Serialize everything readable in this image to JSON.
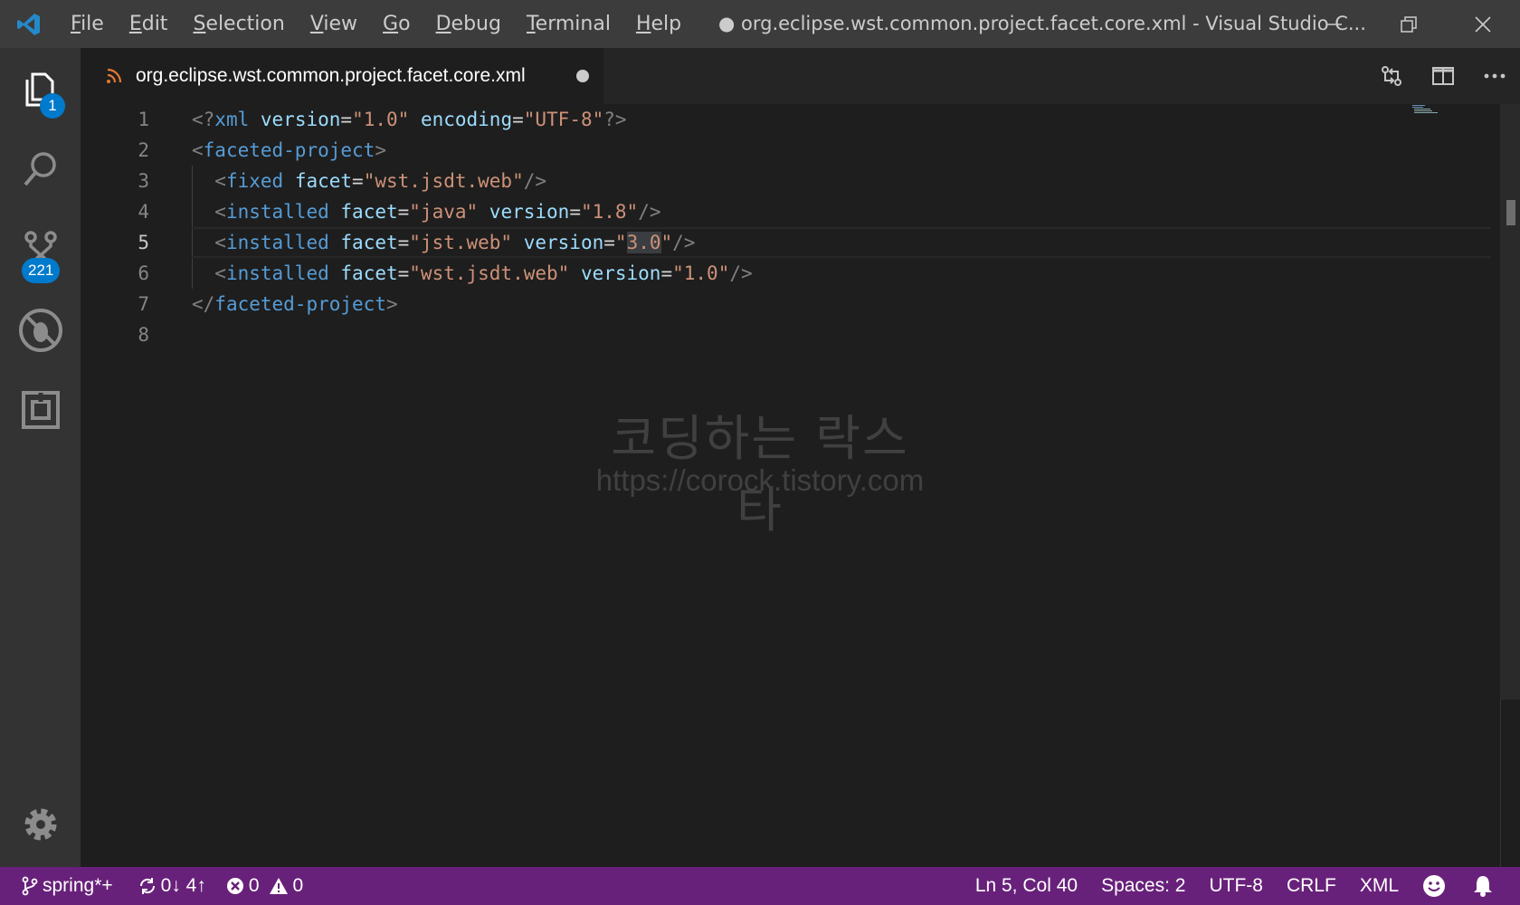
{
  "window": {
    "title": "● org.eclipse.wst.common.project.facet.core.xml - Visual Studio C..."
  },
  "menu": [
    {
      "mnemonic": "F",
      "rest": "ile"
    },
    {
      "mnemonic": "E",
      "rest": "dit"
    },
    {
      "mnemonic": "S",
      "rest": "election"
    },
    {
      "mnemonic": "V",
      "rest": "iew"
    },
    {
      "mnemonic": "G",
      "rest": "o"
    },
    {
      "mnemonic": "D",
      "rest": "ebug"
    },
    {
      "mnemonic": "T",
      "rest": "erminal"
    },
    {
      "mnemonic": "H",
      "rest": "elp"
    }
  ],
  "activity": {
    "explorer_badge": "1",
    "scm_badge": "221"
  },
  "tab": {
    "label": "org.eclipse.wst.common.project.facet.core.xml"
  },
  "editor": {
    "line_numbers": [
      "1",
      "2",
      "3",
      "4",
      "5",
      "6",
      "7",
      "8"
    ],
    "lines": [
      [
        [
          "punc",
          "<?"
        ],
        [
          "tag",
          "xml"
        ],
        [
          "eq",
          " "
        ],
        [
          "attr",
          "version"
        ],
        [
          "eq",
          "="
        ],
        [
          "str",
          "\"1.0\""
        ],
        [
          "eq",
          " "
        ],
        [
          "attr",
          "encoding"
        ],
        [
          "eq",
          "="
        ],
        [
          "str",
          "\"UTF-8\""
        ],
        [
          "punc",
          "?>"
        ]
      ],
      [
        [
          "punc",
          "<"
        ],
        [
          "tag",
          "faceted-project"
        ],
        [
          "punc",
          ">"
        ]
      ],
      [
        [
          "eq",
          "  "
        ],
        [
          "punc",
          "<"
        ],
        [
          "tag",
          "fixed"
        ],
        [
          "eq",
          " "
        ],
        [
          "attr",
          "facet"
        ],
        [
          "eq",
          "="
        ],
        [
          "str",
          "\"wst.jsdt.web\""
        ],
        [
          "punc",
          "/>"
        ]
      ],
      [
        [
          "eq",
          "  "
        ],
        [
          "punc",
          "<"
        ],
        [
          "tag",
          "installed"
        ],
        [
          "eq",
          " "
        ],
        [
          "attr",
          "facet"
        ],
        [
          "eq",
          "="
        ],
        [
          "str",
          "\"java\""
        ],
        [
          "eq",
          " "
        ],
        [
          "attr",
          "version"
        ],
        [
          "eq",
          "="
        ],
        [
          "str",
          "\"1.8\""
        ],
        [
          "punc",
          "/>"
        ]
      ],
      [
        [
          "eq",
          "  "
        ],
        [
          "punc",
          "<"
        ],
        [
          "tag",
          "installed"
        ],
        [
          "eq",
          " "
        ],
        [
          "attr",
          "facet"
        ],
        [
          "eq",
          "="
        ],
        [
          "str",
          "\"jst.web\""
        ],
        [
          "eq",
          " "
        ],
        [
          "attr",
          "version"
        ],
        [
          "eq",
          "="
        ],
        [
          "str",
          "\""
        ],
        [
          "sel",
          "3.0"
        ],
        [
          "str",
          "\""
        ],
        [
          "punc",
          "/>"
        ]
      ],
      [
        [
          "eq",
          "  "
        ],
        [
          "punc",
          "<"
        ],
        [
          "tag",
          "installed"
        ],
        [
          "eq",
          " "
        ],
        [
          "attr",
          "facet"
        ],
        [
          "eq",
          "="
        ],
        [
          "str",
          "\"wst.jsdt.web\""
        ],
        [
          "eq",
          " "
        ],
        [
          "attr",
          "version"
        ],
        [
          "eq",
          "="
        ],
        [
          "str",
          "\"1.0\""
        ],
        [
          "punc",
          "/>"
        ]
      ],
      [
        [
          "punc",
          "</"
        ],
        [
          "tag",
          "faceted-project"
        ],
        [
          "punc",
          ">"
        ]
      ],
      []
    ],
    "active_line": 5
  },
  "watermark": {
    "title": "코딩하는 락스타",
    "url": "https://corock.tistory.com"
  },
  "statusbar": {
    "branch": "spring*+",
    "sync": "0↓ 4↑",
    "errors": "0",
    "warnings": "0",
    "position": "Ln 5, Col 40",
    "indent": "Spaces: 2",
    "encoding": "UTF-8",
    "eol": "CRLF",
    "language": "XML"
  },
  "colors": {
    "statusbar": "#68217a",
    "accent": "#007acc",
    "tag": "#569cd6",
    "attribute": "#9cdcfe",
    "string": "#ce9178"
  }
}
